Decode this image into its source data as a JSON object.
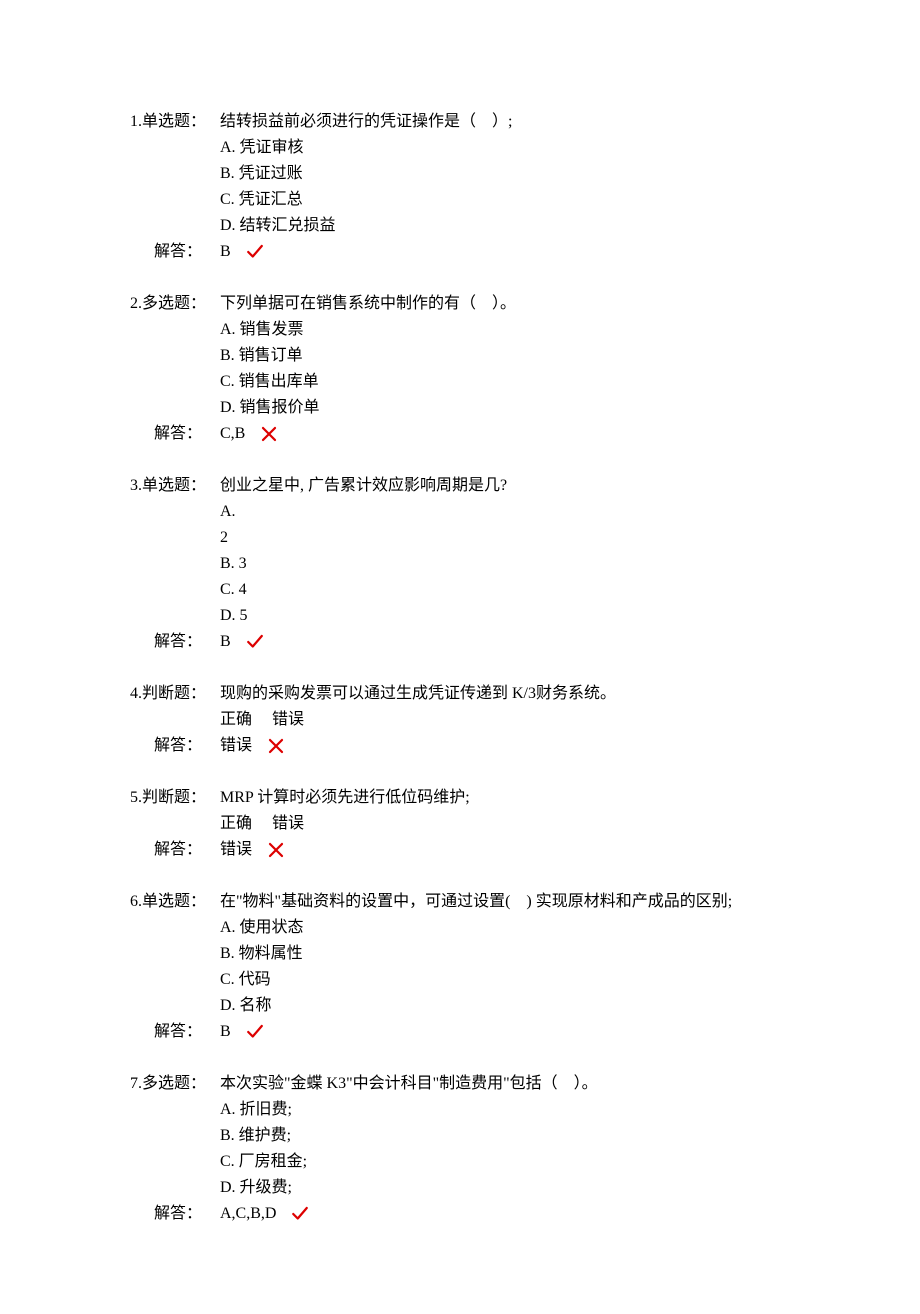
{
  "answer_label": "解答：",
  "tf_correct": "正确",
  "tf_wrong": "错误",
  "questions": [
    {
      "num": "1.单选题：",
      "text": "结转损益前必须进行的凭证操作是（　）;",
      "options": [
        "A. 凭证审核",
        "B. 凭证过账",
        "C. 凭证汇总",
        "D. 结转汇兑损益"
      ],
      "answer": "B",
      "mark": "correct"
    },
    {
      "num": "2.多选题：",
      "text": "下列单据可在销售系统中制作的有（　）。",
      "options": [
        "A. 销售发票",
        "B. 销售订单",
        "C. 销售出库单",
        "D. 销售报价单"
      ],
      "answer": "C,B",
      "mark": "wrong"
    },
    {
      "num": "3.单选题：",
      "text": "创业之星中, 广告累计效应影响周期是几?",
      "options": [
        "A.",
        "2",
        "B. 3",
        "C. 4",
        "D. 5"
      ],
      "answer": "B",
      "mark": "correct"
    },
    {
      "num": "4.判断题：",
      "text": "现购的采购发票可以通过生成凭证传递到 K/3财务系统。",
      "tf": true,
      "answer": "错误",
      "mark": "wrong"
    },
    {
      "num": "5.判断题：",
      "text": "MRP 计算时必须先进行低位码维护;",
      "tf": true,
      "answer": "错误",
      "mark": "wrong"
    },
    {
      "num": "6.单选题：",
      "text": "在\"物料\"基础资料的设置中，可通过设置(　) 实现原材料和产成品的区别;",
      "options": [
        "A. 使用状态",
        "B. 物料属性",
        "C. 代码",
        "D. 名称"
      ],
      "answer": "B",
      "mark": "correct"
    },
    {
      "num": "7.多选题：",
      "text": "本次实验\"金蝶 K3\"中会计科目\"制造费用\"包括（　）。",
      "options": [
        "A. 折旧费;",
        "B. 维护费;",
        "C. 厂房租金;",
        "D. 升级费;"
      ],
      "answer": "A,C,B,D",
      "mark": "correct"
    }
  ]
}
